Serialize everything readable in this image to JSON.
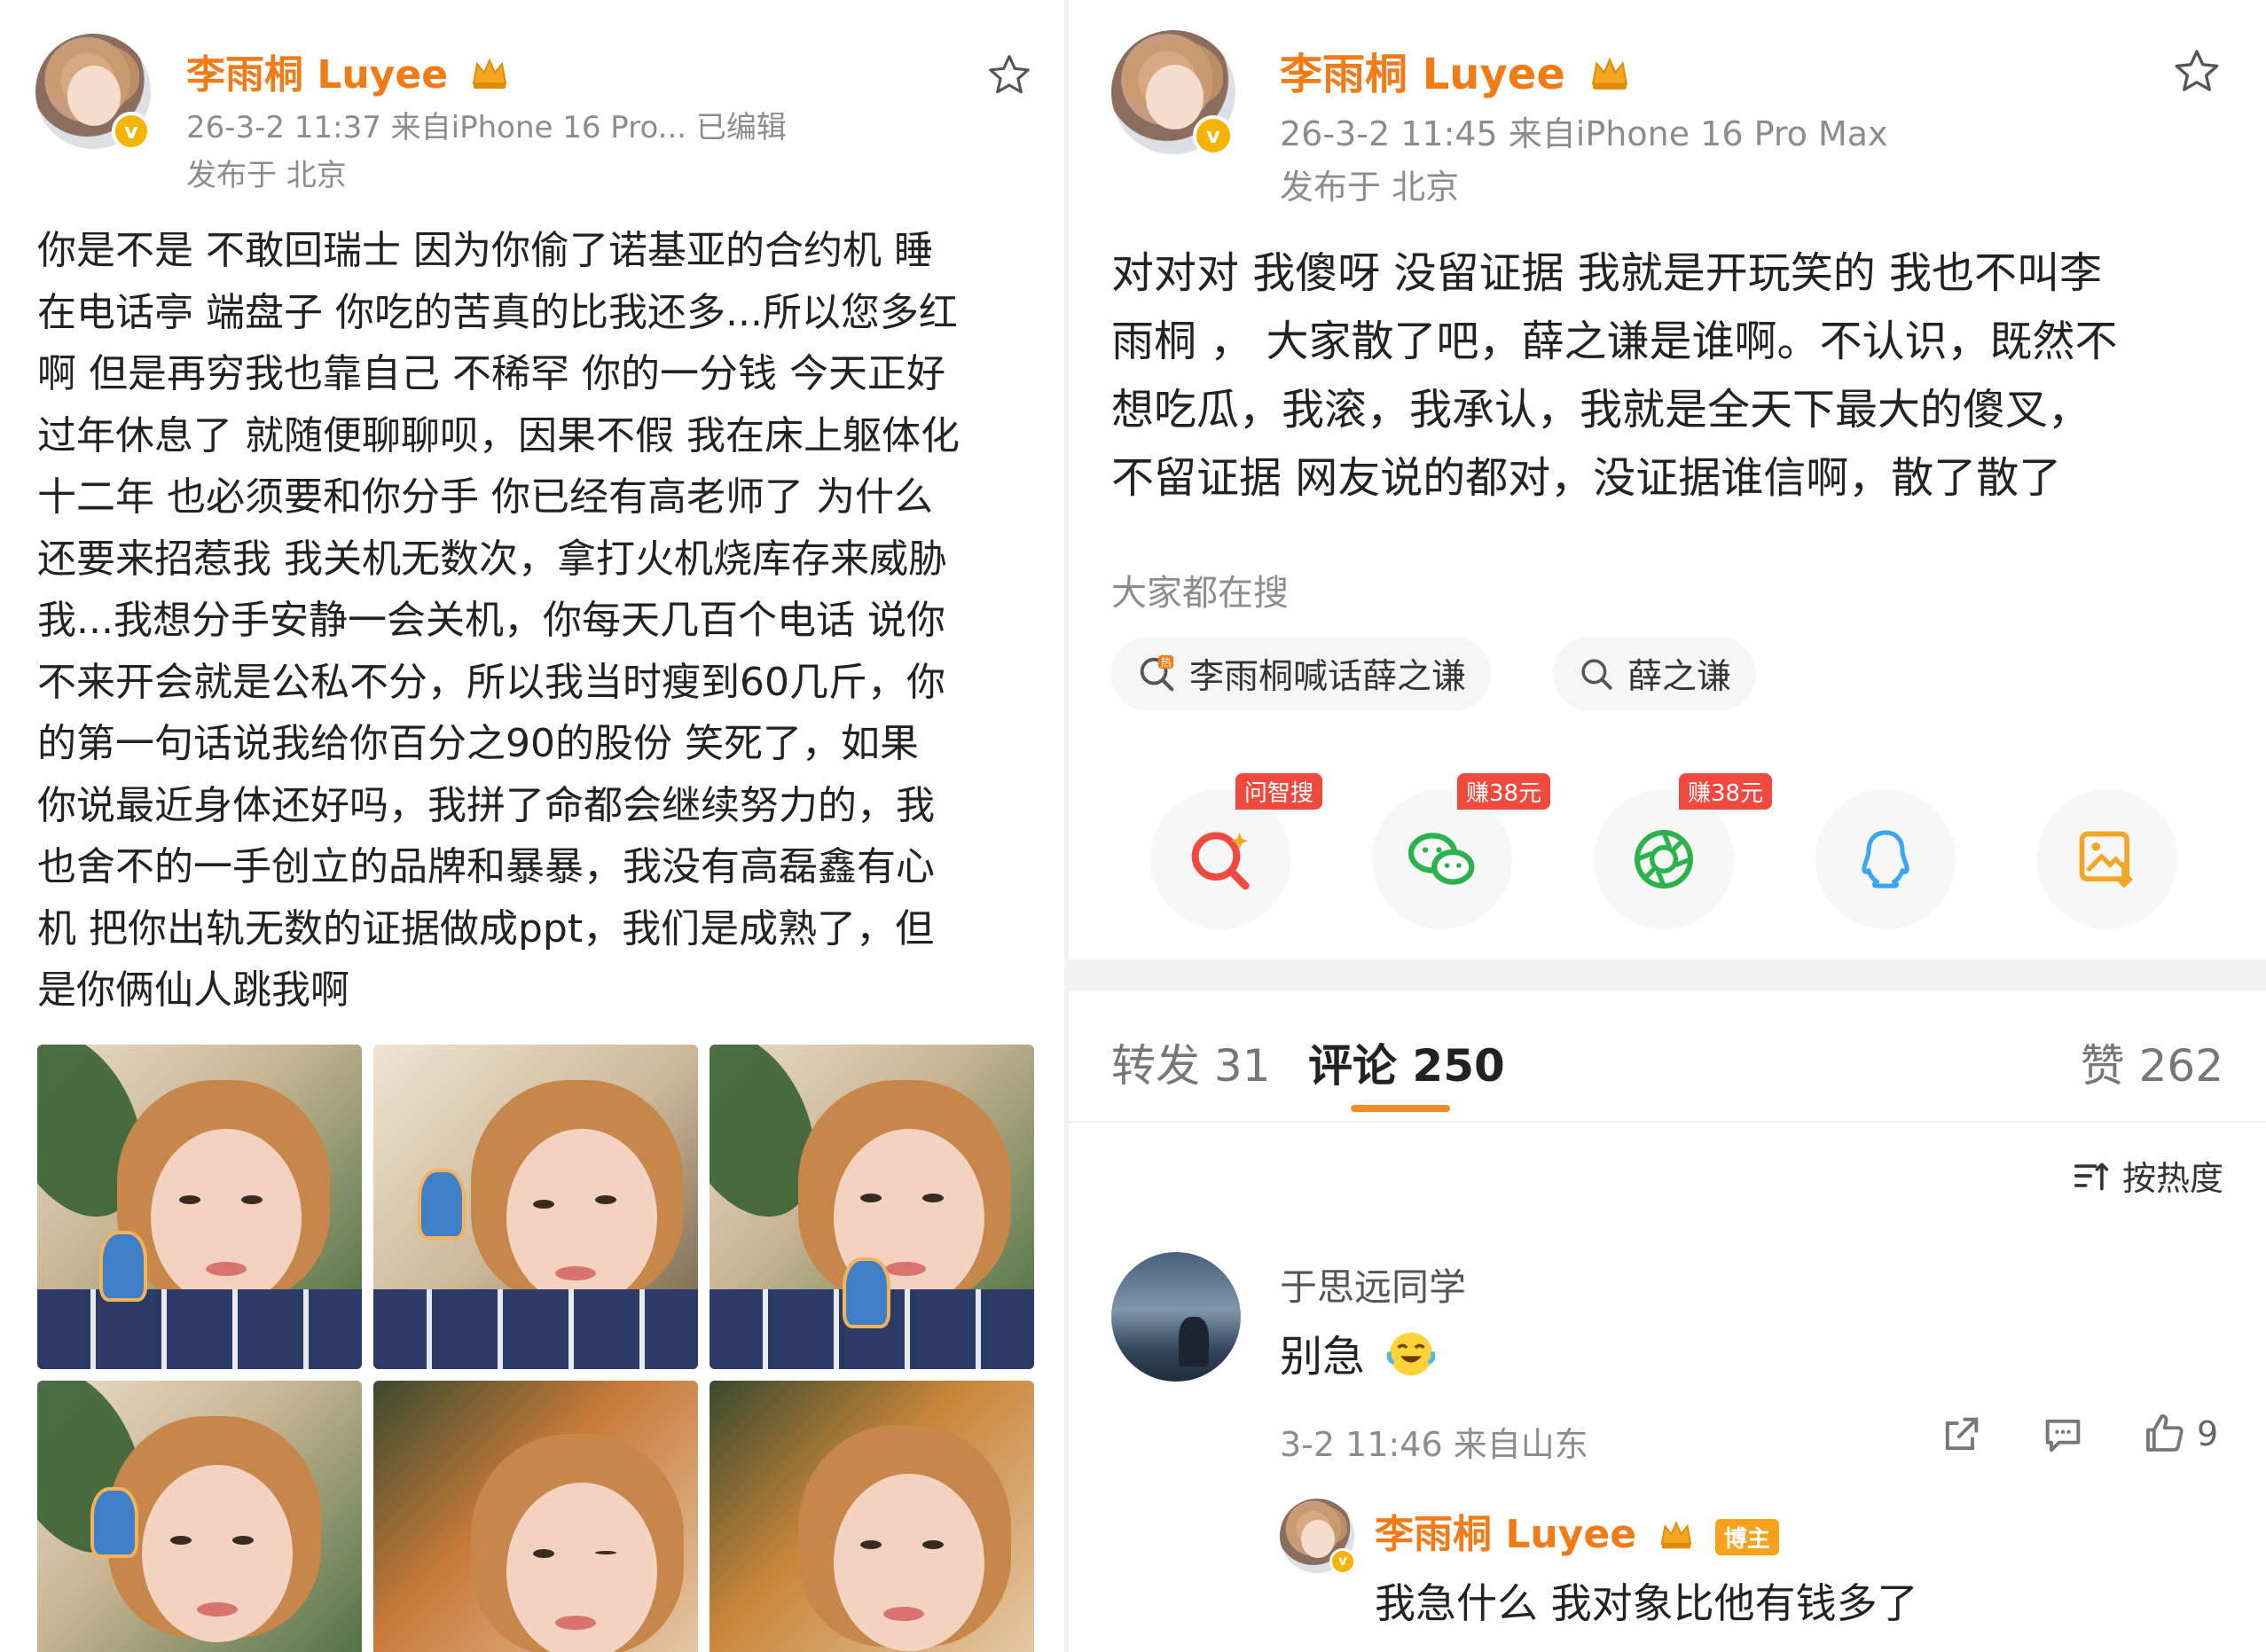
{
  "left_post": {
    "author": "李雨桐 Luyee",
    "time_source": "26-3-2 11:37  来自iPhone 16 Pro...  已编辑",
    "location": "发布于 北京",
    "lines": [
      "你是不是 不敢回瑞士 因为你偷了诺基亚的合约机 睡",
      "在电话亭 端盘子 你吃的苦真的比我还多...所以您多红",
      "啊 但是再穷我也靠自己 不稀罕 你的一分钱 今天正好",
      "过年休息了 就随便聊聊呗，因果不假 我在床上躯体化",
      "十二年 也必须要和你分手 你已经有高老师了 为什么",
      "还要来招惹我 我关机无数次，拿打火机烧库存来威胁",
      "我...我想分手安静一会关机，你每天几百个电话 说你",
      "不来开会就是公私不分，所以我当时瘦到60几斤，你",
      "的第一句话说我给你百分之90的股份 笑死了，如果",
      "你说最近身体还好吗，我拼了命都会继续努力的，我",
      "也舍不的一手创立的品牌和暴暴，我没有高磊鑫有心",
      "机 把你出轨无数的证据做成ppt，我们是成熟了，但",
      "是你俩仙人跳我啊"
    ],
    "photo_count": 6
  },
  "right_post": {
    "author": "李雨桐 Luyee",
    "time_source": "26-3-2 11:45  来自iPhone 16 Pro Max",
    "location": "发布于 北京",
    "lines": [
      "对对对 我傻呀 没留证据 我就是开玩笑的 我也不叫李",
      "雨桐 ， 大家散了吧，薛之谦是谁啊。不认识，既然不",
      "想吃瓜，我滚，我承认，我就是全天下最大的傻叉，",
      "不留证据 网友说的都对，没证据谁信啊，散了散了"
    ],
    "trending_label": "大家都在搜",
    "trending": [
      {
        "label": "李雨桐喊话薛之谦",
        "icon": "hot-search-icon"
      },
      {
        "label": "薛之谦",
        "icon": "search-icon"
      }
    ],
    "share": [
      {
        "badge": "问智搜",
        "icon": "ai-search-icon",
        "color": "#f04a3e"
      },
      {
        "badge": "赚38元",
        "icon": "wechat-icon",
        "color": "#2bb24c"
      },
      {
        "badge": "赚38元",
        "icon": "moments-icon",
        "color": "#2bb24c"
      },
      {
        "badge": "",
        "icon": "qq-icon",
        "color": "#3aa5f0"
      },
      {
        "badge": "",
        "icon": "save-image-icon",
        "color": "#f3a524"
      }
    ],
    "tabs": {
      "repost": "转发 31",
      "comments": "评论 250",
      "likes": "赞 262"
    },
    "sort_label": "按热度",
    "comment": {
      "user": "于思远同学",
      "text": "别急",
      "meta": "3-2 11:46  来自山东",
      "like_count": "9"
    },
    "reply": {
      "user": "李雨桐 Luyee",
      "tag": "博主",
      "text": "我急什么 我对象比他有钱多了"
    }
  },
  "colors": {
    "accent_orange": "#f07b17",
    "tab_underline": "#f08a24",
    "meta_gray": "#8c8c8c",
    "verified_gold": "#f5b400"
  }
}
